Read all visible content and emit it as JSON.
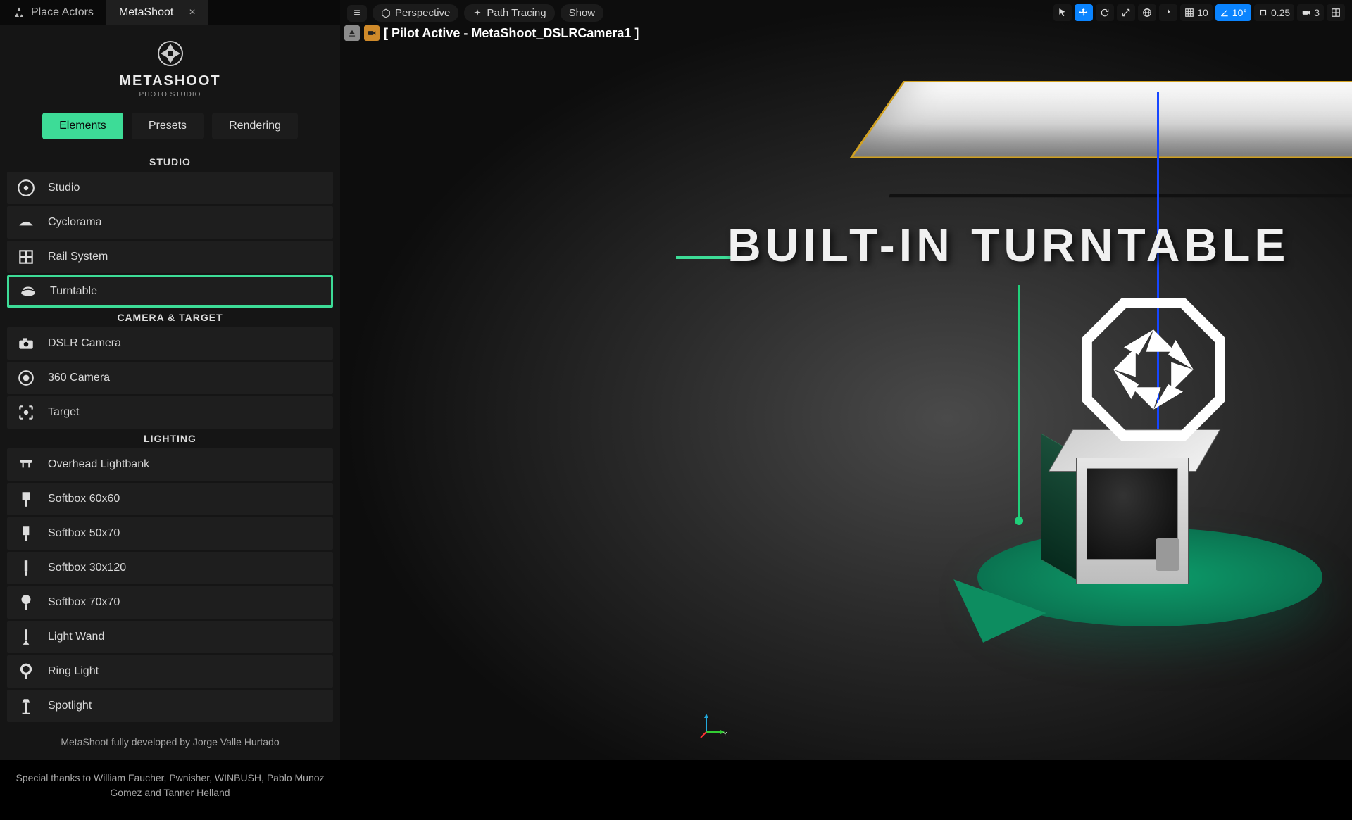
{
  "tabs": {
    "place_actors": "Place Actors",
    "metashoot": "MetaShoot"
  },
  "brand": {
    "name": "METASHOOT",
    "tagline": "PHOTO STUDIO"
  },
  "mode_tabs": {
    "elements": "Elements",
    "presets": "Presets",
    "rendering": "Rendering"
  },
  "sections": {
    "studio": "STUDIO",
    "camera_target": "CAMERA & TARGET",
    "lighting": "LIGHTING"
  },
  "items": {
    "studio": [
      {
        "label": "Studio"
      },
      {
        "label": "Cyclorama"
      },
      {
        "label": "Rail System"
      },
      {
        "label": "Turntable"
      }
    ],
    "camera": [
      {
        "label": "DSLR Camera"
      },
      {
        "label": "360 Camera"
      },
      {
        "label": "Target"
      }
    ],
    "lighting": [
      {
        "label": "Overhead Lightbank"
      },
      {
        "label": "Softbox 60x60"
      },
      {
        "label": "Softbox 50x70"
      },
      {
        "label": "Softbox 30x120"
      },
      {
        "label": "Softbox 70x70"
      },
      {
        "label": "Light Wand"
      },
      {
        "label": "Ring Light"
      },
      {
        "label": "Spotlight"
      }
    ]
  },
  "credits": {
    "main": "MetaShoot fully developed by Jorge Valle Hurtado",
    "thanks": "Special thanks to William Faucher, Pwnisher, WINBUSH, Pablo Munoz Gomez and Tanner Helland"
  },
  "viewport": {
    "menu": "≡",
    "perspective": "Perspective",
    "path_tracing": "Path Tracing",
    "show": "Show",
    "pilot_text": "[ Pilot Active - MetaShoot_DSLRCamera1 ]",
    "grid_snap": "10",
    "angle_snap": "10°",
    "scale_snap": "0.25",
    "cam_speed": "3"
  },
  "overlay": {
    "title": "BUILT-IN TURNTABLE"
  },
  "gizmo": {
    "y_label": "Y"
  },
  "colors": {
    "accent": "#3ddc97",
    "blue": "#0a84ff"
  }
}
